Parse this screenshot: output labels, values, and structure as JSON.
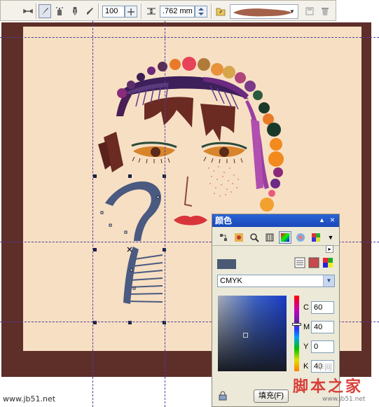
{
  "toolbar": {
    "width_value": "100",
    "outline_value": ".762 mm",
    "icons": [
      "bone-icon",
      "brush-icon",
      "sprayer-icon",
      "calligraphy-pen-icon",
      "pressure-pen-icon",
      "lock-ratio-icon",
      "stroke-width-icon",
      "browse-folder-icon",
      "brush-stroke-preview",
      "save-stroke-icon",
      "delete-stroke-icon"
    ]
  },
  "docker": {
    "title": "颜色",
    "model": "CMYK",
    "labels": {
      "c": "C",
      "m": "M",
      "y": "Y",
      "k": "K"
    },
    "values": {
      "c": "60",
      "m": "40",
      "y": "0",
      "k": "40"
    },
    "current_color": "#4a5a75",
    "fill_button": "填充(F)",
    "tools": [
      "color-viewers-icon",
      "color-palettes-icon",
      "color-eyedropper-icon",
      "color-blend-icon",
      "color-model-icon",
      "color-harmony-icon",
      "color-grid-icon"
    ]
  },
  "colors": {
    "page_border": "#5e2e29",
    "page": "#f7dfc3",
    "hair_dots": [
      "#8a2a7a",
      "#5b2e6a",
      "#3e1f54",
      "#6d2a7a",
      "#5a2d55",
      "#e87a2a",
      "#e8415a",
      "#e85a7a",
      "#d6a64a",
      "#b0457a",
      "#2a5a3e",
      "#193a2a",
      "#f28a1e",
      "#8a2a7a",
      "#6b2a85"
    ]
  },
  "watermark": {
    "url": "www.jb51.net",
    "cn": "脚本之家",
    "cn_url": "www.jb51.net",
    "faint": "华网"
  }
}
